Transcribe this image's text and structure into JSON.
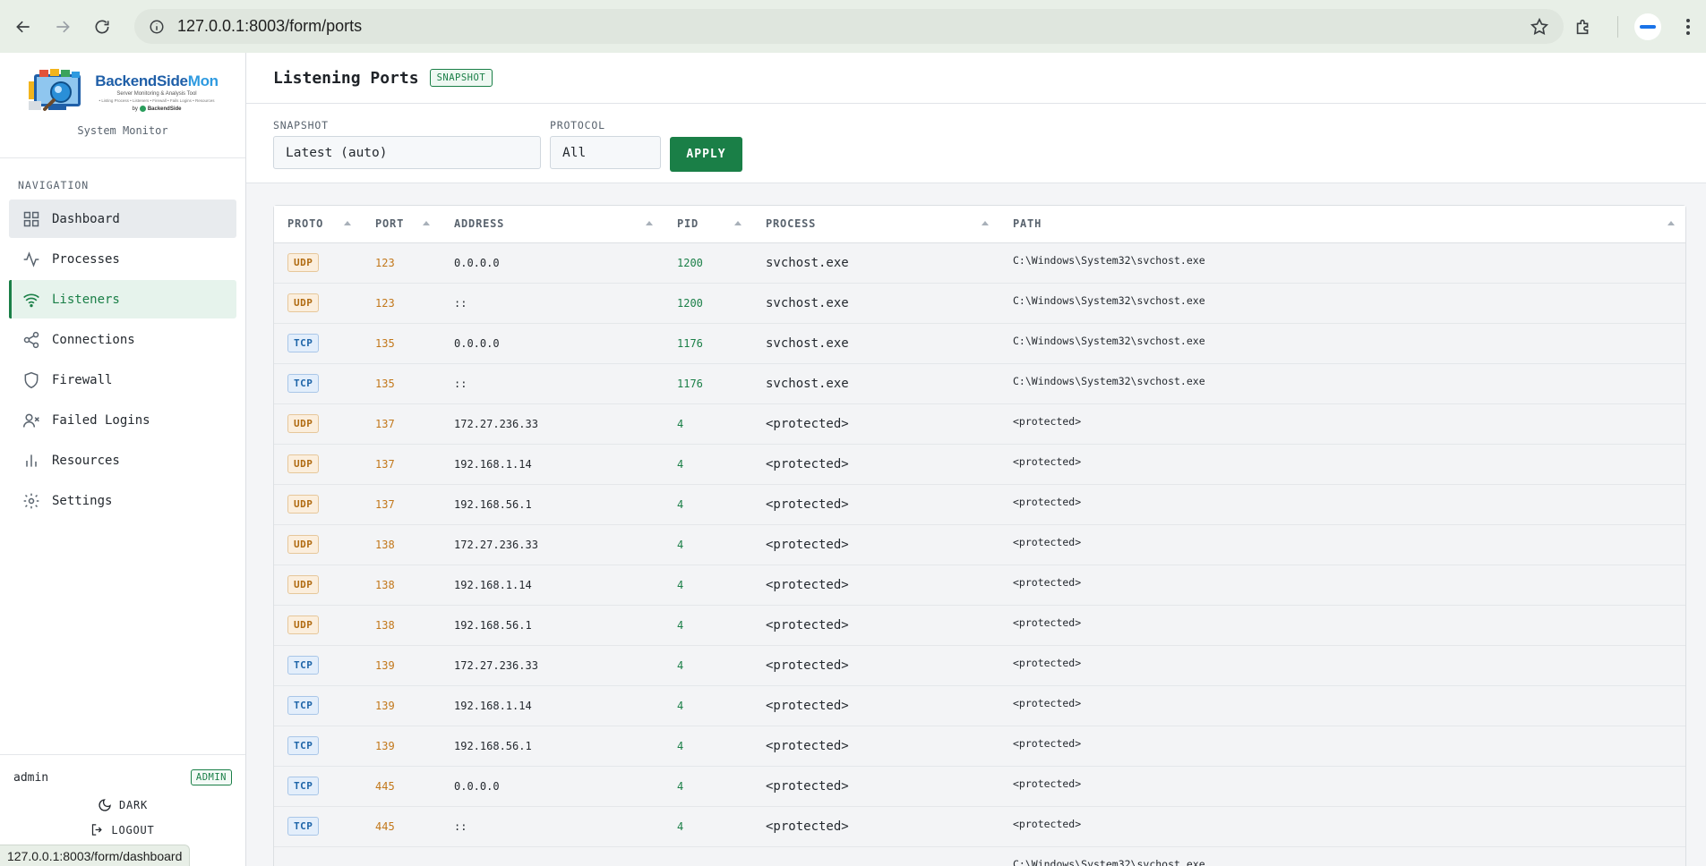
{
  "browser": {
    "url": "127.0.0.1:8003/form/ports",
    "status_url": "127.0.0.1:8003/form/dashboard"
  },
  "sidebar": {
    "logo": {
      "title_a": "BackendSide",
      "title_b": "Mon",
      "subtitle": "Server Monitoring & Analysis Tool",
      "tags": "• Listing Process • Listeners • Firewall • Fails Logins • Resources",
      "by": "by",
      "by_name": "BackendSide"
    },
    "caption": "System Monitor",
    "nav_label": "NAVIGATION",
    "items": [
      {
        "label": "Dashboard",
        "icon": "grid-icon"
      },
      {
        "label": "Processes",
        "icon": "activity-icon"
      },
      {
        "label": "Listeners",
        "icon": "wifi-icon"
      },
      {
        "label": "Connections",
        "icon": "share-icon"
      },
      {
        "label": "Firewall",
        "icon": "shield-icon"
      },
      {
        "label": "Failed Logins",
        "icon": "user-x-icon"
      },
      {
        "label": "Resources",
        "icon": "bar-chart-icon"
      },
      {
        "label": "Settings",
        "icon": "gear-icon"
      }
    ],
    "footer": {
      "user": "admin",
      "role": "ADMIN",
      "theme_toggle": "DARK",
      "logout": "LOGOUT"
    }
  },
  "header": {
    "title": "Listening Ports",
    "badge": "SNAPSHOT"
  },
  "filters": {
    "snapshot_label": "SNAPSHOT",
    "snapshot_value": "Latest (auto)",
    "protocol_label": "PROTOCOL",
    "protocol_value": "All",
    "apply_label": "APPLY"
  },
  "table": {
    "columns": [
      "PROTO",
      "PORT",
      "ADDRESS",
      "PID",
      "PROCESS",
      "PATH"
    ],
    "rows": [
      {
        "proto": "UDP",
        "port": "123",
        "address": "0.0.0.0",
        "pid": "1200",
        "process": "svchost.exe",
        "path": "C:\\Windows\\System32\\svchost.exe"
      },
      {
        "proto": "UDP",
        "port": "123",
        "address": "::",
        "pid": "1200",
        "process": "svchost.exe",
        "path": "C:\\Windows\\System32\\svchost.exe"
      },
      {
        "proto": "TCP",
        "port": "135",
        "address": "0.0.0.0",
        "pid": "1176",
        "process": "svchost.exe",
        "path": "C:\\Windows\\System32\\svchost.exe"
      },
      {
        "proto": "TCP",
        "port": "135",
        "address": "::",
        "pid": "1176",
        "process": "svchost.exe",
        "path": "C:\\Windows\\System32\\svchost.exe"
      },
      {
        "proto": "UDP",
        "port": "137",
        "address": "172.27.236.33",
        "pid": "4",
        "process": "<protected>",
        "path": "<protected>"
      },
      {
        "proto": "UDP",
        "port": "137",
        "address": "192.168.1.14",
        "pid": "4",
        "process": "<protected>",
        "path": "<protected>"
      },
      {
        "proto": "UDP",
        "port": "137",
        "address": "192.168.56.1",
        "pid": "4",
        "process": "<protected>",
        "path": "<protected>"
      },
      {
        "proto": "UDP",
        "port": "138",
        "address": "172.27.236.33",
        "pid": "4",
        "process": "<protected>",
        "path": "<protected>"
      },
      {
        "proto": "UDP",
        "port": "138",
        "address": "192.168.1.14",
        "pid": "4",
        "process": "<protected>",
        "path": "<protected>"
      },
      {
        "proto": "UDP",
        "port": "138",
        "address": "192.168.56.1",
        "pid": "4",
        "process": "<protected>",
        "path": "<protected>"
      },
      {
        "proto": "TCP",
        "port": "139",
        "address": "172.27.236.33",
        "pid": "4",
        "process": "<protected>",
        "path": "<protected>"
      },
      {
        "proto": "TCP",
        "port": "139",
        "address": "192.168.1.14",
        "pid": "4",
        "process": "<protected>",
        "path": "<protected>"
      },
      {
        "proto": "TCP",
        "port": "139",
        "address": "192.168.56.1",
        "pid": "4",
        "process": "<protected>",
        "path": "<protected>"
      },
      {
        "proto": "TCP",
        "port": "445",
        "address": "0.0.0.0",
        "pid": "4",
        "process": "<protected>",
        "path": "<protected>"
      },
      {
        "proto": "TCP",
        "port": "445",
        "address": "::",
        "pid": "4",
        "process": "<protected>",
        "path": "<protected>"
      }
    ],
    "partial_last_path": "C:\\Windows\\System32\\svchost.exe"
  },
  "colors": {
    "accent": "#1a7f47",
    "port": "#c2771a",
    "udp": "#b06a10",
    "tcp": "#1d64a8"
  }
}
